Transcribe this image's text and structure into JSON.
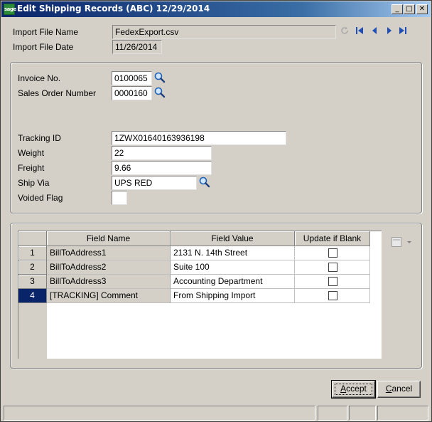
{
  "window": {
    "app_icon_text": "sage",
    "title": "Edit Shipping Records (ABC) 12/29/2014",
    "minimize_glyph": "_",
    "maximize_glyph": "□",
    "close_glyph": "✕"
  },
  "header": {
    "import_file_name_label": "Import File Name",
    "import_file_name_value": "FedexExport.csv",
    "import_file_date_label": "Import File Date",
    "import_file_date_value": "11/26/2014"
  },
  "form": {
    "invoice_no_label": "Invoice No.",
    "invoice_no_value": "0100065",
    "sales_order_label": "Sales Order Number",
    "sales_order_value": "0000160",
    "tracking_id_label": "Tracking ID",
    "tracking_id_value": "1ZWX01640163936198",
    "weight_label": "Weight",
    "weight_value": "22",
    "freight_label": "Freight",
    "freight_value": "9.66",
    "ship_via_label": "Ship Via",
    "ship_via_value": "UPS RED",
    "voided_flag_label": "Voided Flag",
    "voided_flag_value": ""
  },
  "grid": {
    "columns": [
      "Field Name",
      "Field Value",
      "Update if Blank"
    ],
    "rows": [
      {
        "num": "1",
        "field_name": "BillToAddress1",
        "field_value": "2131 N. 14th Street",
        "update_if_blank": false
      },
      {
        "num": "2",
        "field_name": "BillToAddress2",
        "field_value": "Suite 100",
        "update_if_blank": false
      },
      {
        "num": "3",
        "field_name": "BillToAddress3",
        "field_value": "Accounting Department",
        "update_if_blank": false
      },
      {
        "num": "4",
        "field_name": "[TRACKING] Comment",
        "field_value": "From Shipping Import",
        "update_if_blank": false
      }
    ],
    "selected_row": "4"
  },
  "buttons": {
    "accept_prefix": "",
    "accept_underlined": "A",
    "accept_rest": "ccept",
    "cancel_prefix": "",
    "cancel_underlined": "C",
    "cancel_rest": "ancel"
  },
  "icons": {
    "lookup": "magnifier-icon",
    "nav_first": "first-record-icon",
    "nav_prev": "previous-record-icon",
    "nav_next": "next-record-icon",
    "nav_last": "last-record-icon",
    "refresh": "refresh-icon",
    "grid_menu": "grid-customizer-icon"
  },
  "colors": {
    "title_bar": "#0a246a",
    "selected_row": "#0a246a",
    "nav_arrows": "#1f4fb5",
    "background": "#d4d0c8"
  }
}
